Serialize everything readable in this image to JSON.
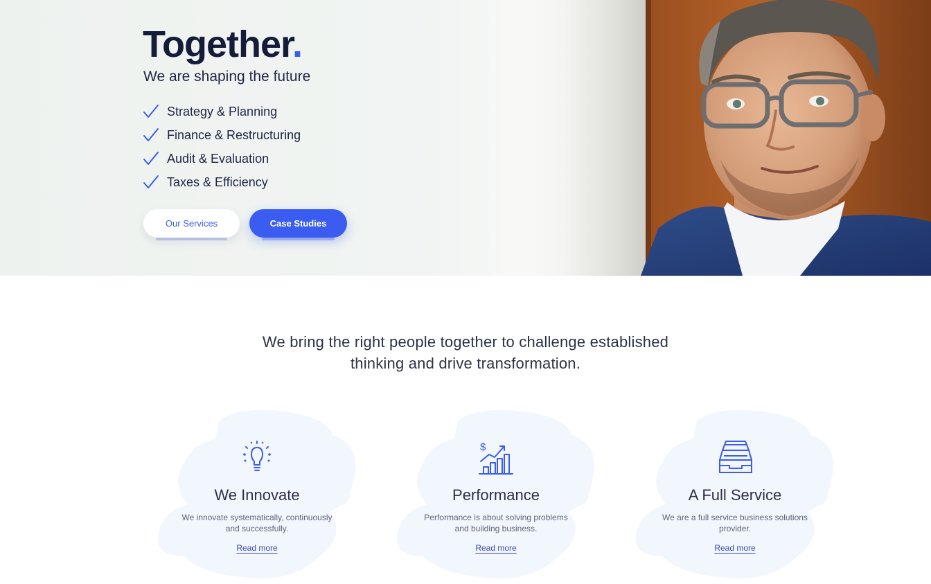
{
  "hero": {
    "title": "Together",
    "title_dot": ".",
    "subtitle": "We are shaping the future",
    "checklist": [
      "Strategy & Planning",
      "Finance & Restructuring",
      "Audit & Evaluation",
      "Taxes & Efficiency"
    ],
    "buttons": {
      "services": "Our Services",
      "cases": "Case Studies"
    }
  },
  "intro": {
    "line1": "We bring the right people together to challenge established",
    "line2": "thinking and drive transformation."
  },
  "features": [
    {
      "icon": "lightbulb-icon",
      "title": "We Innovate",
      "desc_line1": "We innovate systematically, continuously",
      "desc_line2": "and successfully.",
      "link": "Read more"
    },
    {
      "icon": "growth-chart-icon",
      "title": "Performance",
      "desc_line1": "Performance is about solving problems",
      "desc_line2": "and building business.",
      "link": "Read more"
    },
    {
      "icon": "inbox-tray-icon",
      "title": "A Full Service",
      "desc_line1": "We are a full service business solutions",
      "desc_line2": "provider.",
      "link": "Read more"
    }
  ],
  "colors": {
    "accent": "#3a5cf0",
    "heading": "#141c3a",
    "blob": "#f2f6fd"
  }
}
